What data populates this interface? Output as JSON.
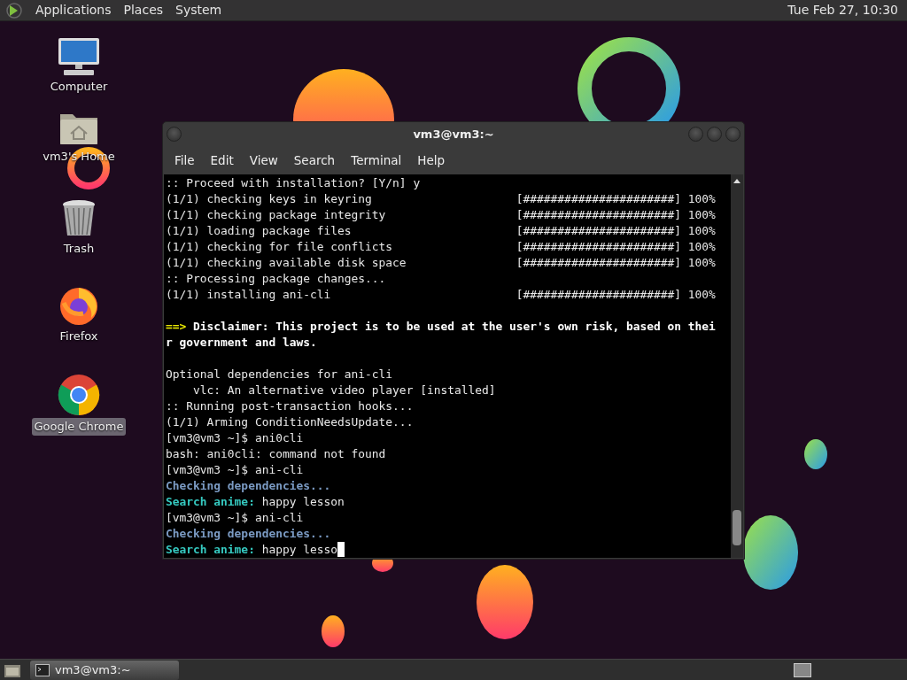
{
  "top_panel": {
    "menus": [
      "Applications",
      "Places",
      "System"
    ],
    "clock": "Tue Feb 27, 10:30"
  },
  "desktop_icons": [
    {
      "label": "Computer",
      "kind": "computer",
      "selected": false
    },
    {
      "label": "vm3's Home",
      "kind": "home",
      "selected": false
    },
    {
      "label": "Trash",
      "kind": "trash",
      "selected": false
    },
    {
      "label": "Firefox",
      "kind": "firefox",
      "selected": false
    },
    {
      "label": "Google Chrome",
      "kind": "chrome",
      "selected": true
    }
  ],
  "terminal": {
    "title": "vm3@vm3:~",
    "menu": [
      "File",
      "Edit",
      "View",
      "Search",
      "Terminal",
      "Help"
    ],
    "lines": [
      {
        "segments": [
          {
            "text": ":: Proceed with installation? [Y/n] y",
            "kind": "plain"
          }
        ]
      },
      {
        "segments": [
          {
            "text": "(1/1) checking keys in keyring",
            "kind": "plain"
          }
        ],
        "progress": "[######################] 100%"
      },
      {
        "segments": [
          {
            "text": "(1/1) checking package integrity",
            "kind": "plain"
          }
        ],
        "progress": "[######################] 100%"
      },
      {
        "segments": [
          {
            "text": "(1/1) loading package files",
            "kind": "plain"
          }
        ],
        "progress": "[######################] 100%"
      },
      {
        "segments": [
          {
            "text": "(1/1) checking for file conflicts",
            "kind": "plain"
          }
        ],
        "progress": "[######################] 100%"
      },
      {
        "segments": [
          {
            "text": "(1/1) checking available disk space",
            "kind": "plain"
          }
        ],
        "progress": "[######################] 100%"
      },
      {
        "segments": [
          {
            "text": ":: Processing package changes...",
            "kind": "plain"
          }
        ]
      },
      {
        "segments": [
          {
            "text": "(1/1) installing ani-cli",
            "kind": "plain"
          }
        ],
        "progress": "[######################] 100%"
      },
      {
        "kind": "blank"
      },
      {
        "segments": [
          {
            "text": "==>",
            "kind": "arrow"
          },
          {
            "text": " Disclaimer: This project is to be used at the user's own risk, based on thei",
            "kind": "bold"
          }
        ]
      },
      {
        "segments": [
          {
            "text": "r government and laws.",
            "kind": "bold"
          }
        ]
      },
      {
        "kind": "blank"
      },
      {
        "segments": [
          {
            "text": "Optional dependencies for ani-cli",
            "kind": "plain"
          }
        ]
      },
      {
        "segments": [
          {
            "text": "    vlc: An alternative video player [installed]",
            "kind": "plain"
          }
        ]
      },
      {
        "segments": [
          {
            "text": ":: Running post-transaction hooks...",
            "kind": "plain"
          }
        ]
      },
      {
        "segments": [
          {
            "text": "(1/1) Arming ConditionNeedsUpdate...",
            "kind": "plain"
          }
        ]
      },
      {
        "segments": [
          {
            "text": "[vm3@vm3 ~]$ ani0cli",
            "kind": "plain"
          }
        ]
      },
      {
        "segments": [
          {
            "text": "bash: ani0cli: command not found",
            "kind": "plain"
          }
        ]
      },
      {
        "segments": [
          {
            "text": "[vm3@vm3 ~]$ ani-cli",
            "kind": "plain"
          }
        ]
      },
      {
        "segments": [
          {
            "text": "Checking dependencies...",
            "kind": "info"
          }
        ]
      },
      {
        "segments": [
          {
            "text": "Search anime:",
            "kind": "label"
          },
          {
            "text": " happy lesson",
            "kind": "plain"
          }
        ]
      },
      {
        "segments": [
          {
            "text": "[vm3@vm3 ~]$ ani-cli",
            "kind": "plain"
          }
        ]
      },
      {
        "segments": [
          {
            "text": "Checking dependencies...",
            "kind": "info"
          }
        ]
      },
      {
        "segments": [
          {
            "text": "Search anime:",
            "kind": "label"
          },
          {
            "text": " happy lesso",
            "kind": "plain"
          }
        ],
        "cursor": true
      }
    ]
  },
  "taskbar": {
    "tasks": [
      {
        "label": "vm3@vm3:~",
        "selected": true
      }
    ]
  }
}
